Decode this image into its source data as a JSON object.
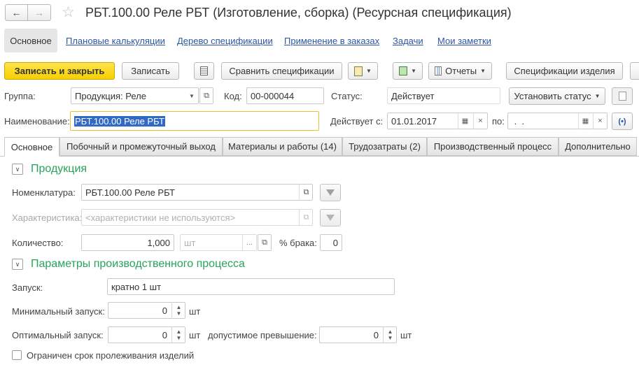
{
  "window": {
    "title": "РБТ.100.00 Реле РБТ (Изготовление, сборка) (Ресурсная спецификация)"
  },
  "nav": {
    "items": [
      "Основное",
      "Плановые калькуляции",
      "Дерево спецификации",
      "Применение в заказах",
      "Задачи",
      "Мои заметки"
    ]
  },
  "toolbar": {
    "save_close": "Записать и закрыть",
    "save": "Записать",
    "compare": "Сравнить спецификации",
    "reports": "Отчеты",
    "product_specs": "Спецификации изделия"
  },
  "header": {
    "group_label": "Группа:",
    "group_value": "Продукция: Реле",
    "code_label": "Код:",
    "code_value": "00-000044",
    "status_label": "Статус:",
    "status_value": "Действует",
    "set_status": "Установить статус",
    "name_label": "Наименование:",
    "name_value": "РБТ.100.00 Реле РБТ",
    "valid_from_label": "Действует с:",
    "valid_from_value": "01.01.2017",
    "valid_to_label": "по:",
    "valid_to_value": " .  ."
  },
  "tabs": [
    "Основное",
    "Побочный и промежуточный выход",
    "Материалы и работы (14)",
    "Трудозатраты (2)",
    "Производственный процесс",
    "Дополнительно"
  ],
  "product": {
    "section_title": "Продукция",
    "nomenclature_label": "Номенклатура:",
    "nomenclature_value": "РБТ.100.00 Реле РБТ",
    "characteristic_label": "Характеристика:",
    "characteristic_placeholder": "<характеристики не используются>",
    "quantity_label": "Количество:",
    "quantity_value": "1,000",
    "unit_value": "шт",
    "defect_label": "% брака:",
    "defect_value": "0"
  },
  "process": {
    "section_title": "Параметры производственного процесса",
    "launch_label": "Запуск:",
    "launch_value": "кратно 1 шт",
    "min_label": "Минимальный запуск:",
    "min_value": "0",
    "min_unit": "шт",
    "opt_label": "Оптимальный запуск:",
    "opt_value": "0",
    "opt_unit": "шт",
    "excess_label": "допустимое превышение:",
    "excess_value": "0",
    "excess_unit": "шт",
    "shelf_label": "Ограничен срок пролеживания изделий"
  }
}
